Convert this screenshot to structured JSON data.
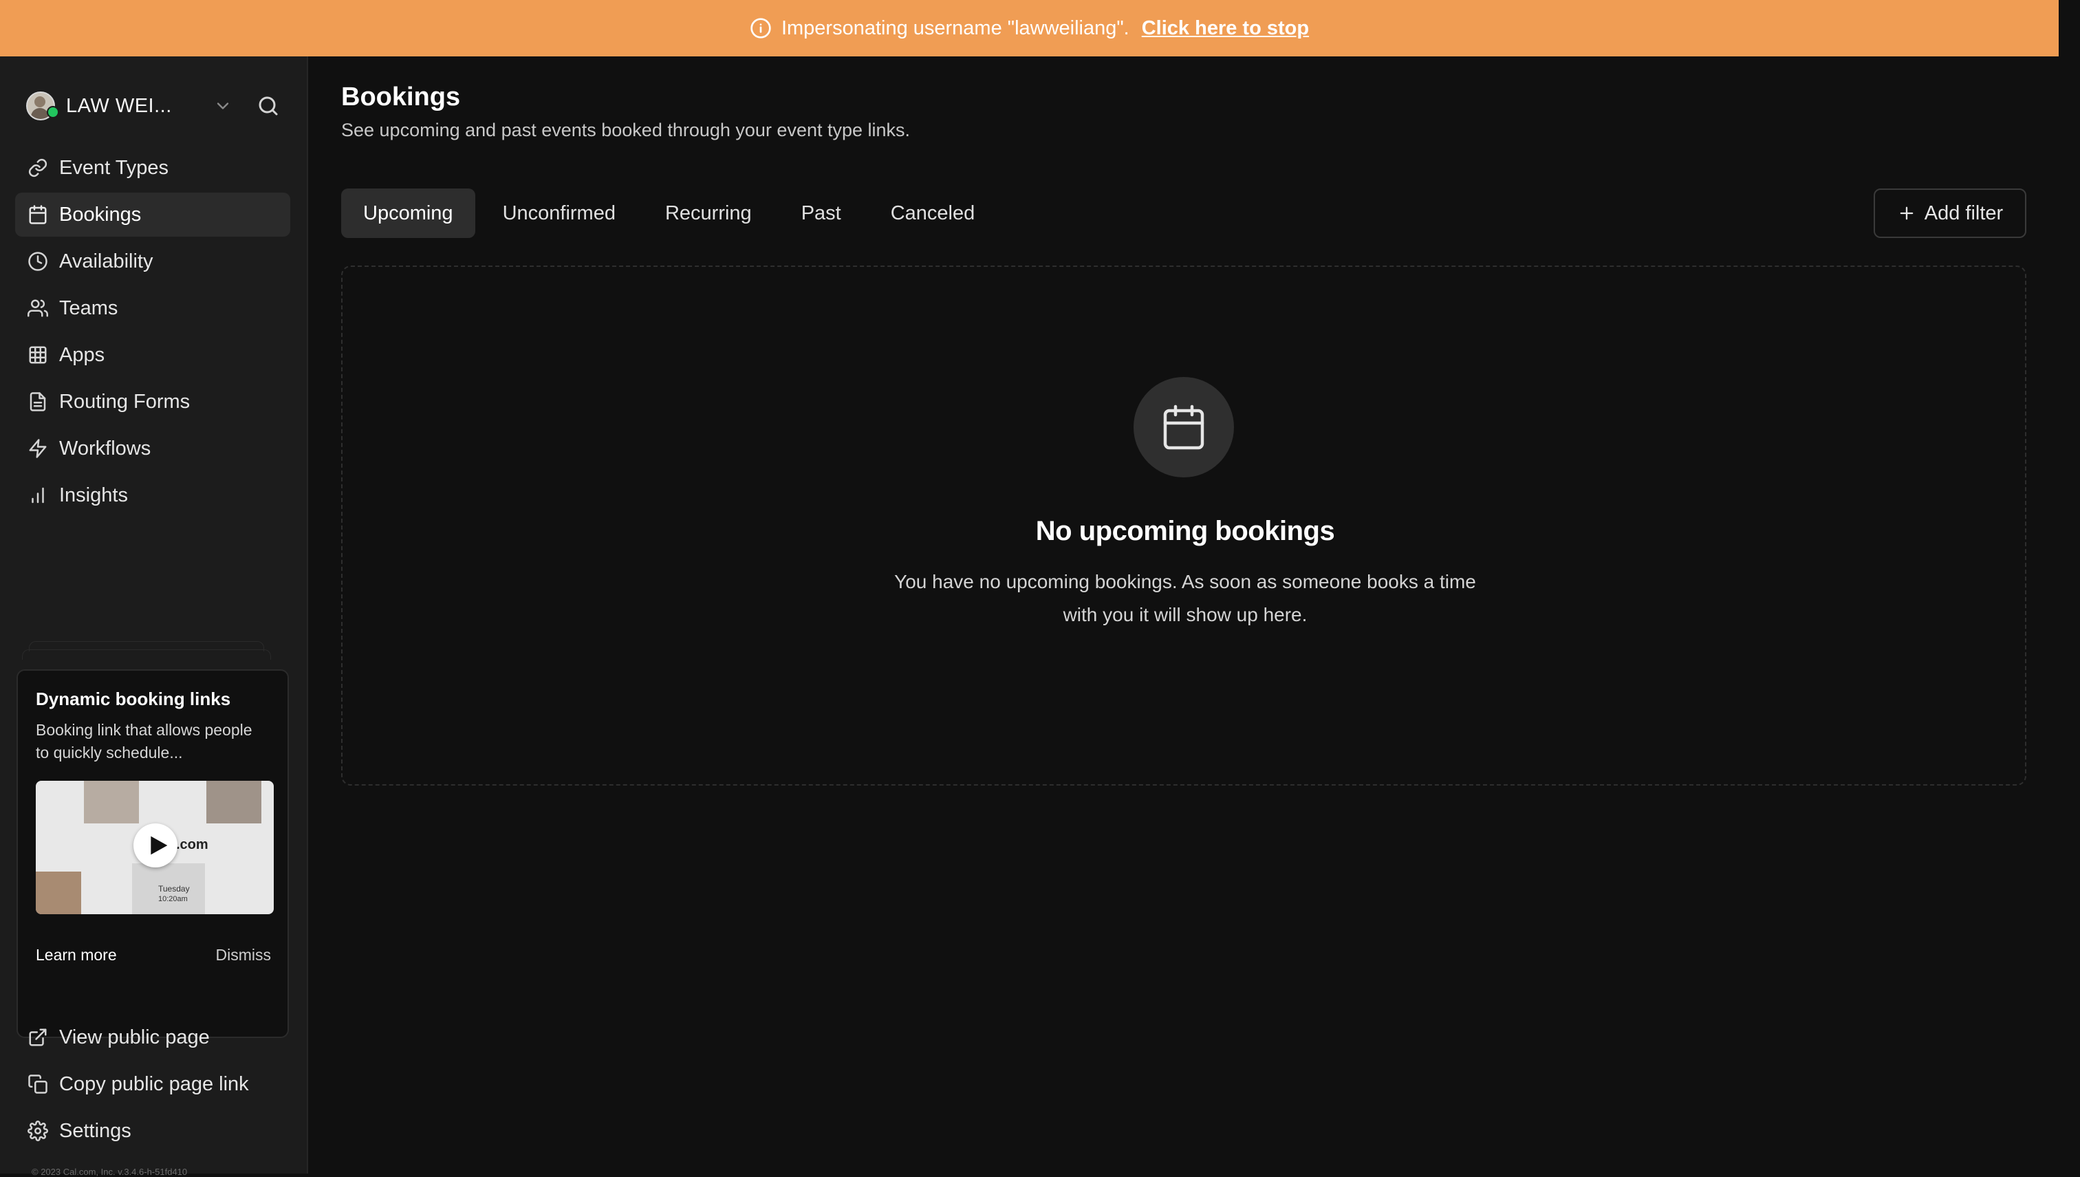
{
  "banner": {
    "message": "Impersonating username \"lawweiliang\".",
    "stop_link": "Click here to stop",
    "bg_color": "#f09d54"
  },
  "user": {
    "name": "LAW WEI...",
    "status": "online"
  },
  "sidebar": {
    "items": [
      {
        "label": "Event Types",
        "icon": "link-icon"
      },
      {
        "label": "Bookings",
        "icon": "calendar-icon",
        "active": true
      },
      {
        "label": "Availability",
        "icon": "clock-icon"
      },
      {
        "label": "Teams",
        "icon": "users-icon"
      },
      {
        "label": "Apps",
        "icon": "grid-icon"
      },
      {
        "label": "Routing Forms",
        "icon": "file-text-icon"
      },
      {
        "label": "Workflows",
        "icon": "zap-icon"
      },
      {
        "label": "Insights",
        "icon": "bar-chart-icon"
      }
    ],
    "bottom_items": [
      {
        "label": "View public page",
        "icon": "external-link-icon"
      },
      {
        "label": "Copy public page link",
        "icon": "copy-icon"
      },
      {
        "label": "Settings",
        "icon": "settings-icon"
      }
    ],
    "footer": "© 2023 Cal.com, Inc. v.3.4.6-h-51fd410"
  },
  "promo": {
    "title": "Dynamic booking links",
    "description": "Booking link that allows people to quickly schedule...",
    "thumb_text": ".com",
    "thumb_day": "Tuesday",
    "thumb_time": "10:20am",
    "learn_more": "Learn more",
    "dismiss": "Dismiss"
  },
  "page": {
    "title": "Bookings",
    "subtitle": "See upcoming and past events booked through your event type links."
  },
  "tabs": [
    {
      "label": "Upcoming",
      "active": true
    },
    {
      "label": "Unconfirmed"
    },
    {
      "label": "Recurring"
    },
    {
      "label": "Past"
    },
    {
      "label": "Canceled"
    }
  ],
  "filter": {
    "label": "Add filter"
  },
  "empty_state": {
    "icon": "calendar-icon",
    "title": "No upcoming bookings",
    "description": "You have no upcoming bookings. As soon as someone books a time with you it will show up here."
  }
}
